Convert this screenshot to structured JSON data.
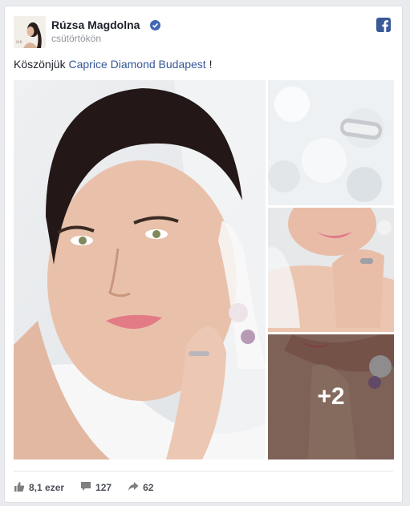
{
  "post": {
    "author": "Rúzsa Magdolna",
    "time": "csütörtökön",
    "message_prefix": "Köszönjük ",
    "message_link": "Caprice Diamond Budapest",
    "message_suffix": " !"
  },
  "photos": {
    "more_count": "+2"
  },
  "footer": {
    "likes": "8,1 ezer",
    "comments": "127",
    "shares": "62"
  },
  "colors": {
    "brand": "#3b5998",
    "link": "#365899",
    "verified": "#4267b2"
  },
  "icons": [
    "facebook-icon",
    "verified-icon",
    "like-icon",
    "comment-icon",
    "share-icon"
  ]
}
